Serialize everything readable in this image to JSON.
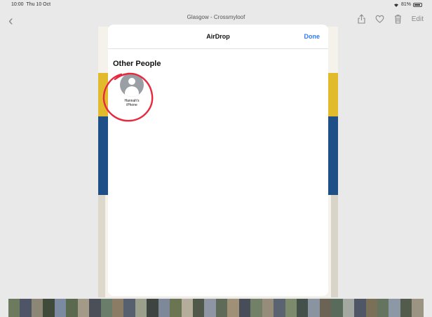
{
  "status_bar": {
    "time": "10:00",
    "date": "Thu 10 Oct",
    "battery": "81%",
    "wifi_icon": "wifi-icon"
  },
  "photo": {
    "title": "Glasgow - Crossmyloof"
  },
  "nav": {
    "back_icon": "chevron-left-icon",
    "edit_label": "Edit"
  },
  "airdrop": {
    "title": "AirDrop",
    "done_label": "Done",
    "section_heading": "Other People",
    "people": [
      {
        "name_line1": "Hannah's",
        "name_line2": "iPhone"
      }
    ]
  },
  "annotation": {
    "highlight_color": "#e8283f"
  }
}
